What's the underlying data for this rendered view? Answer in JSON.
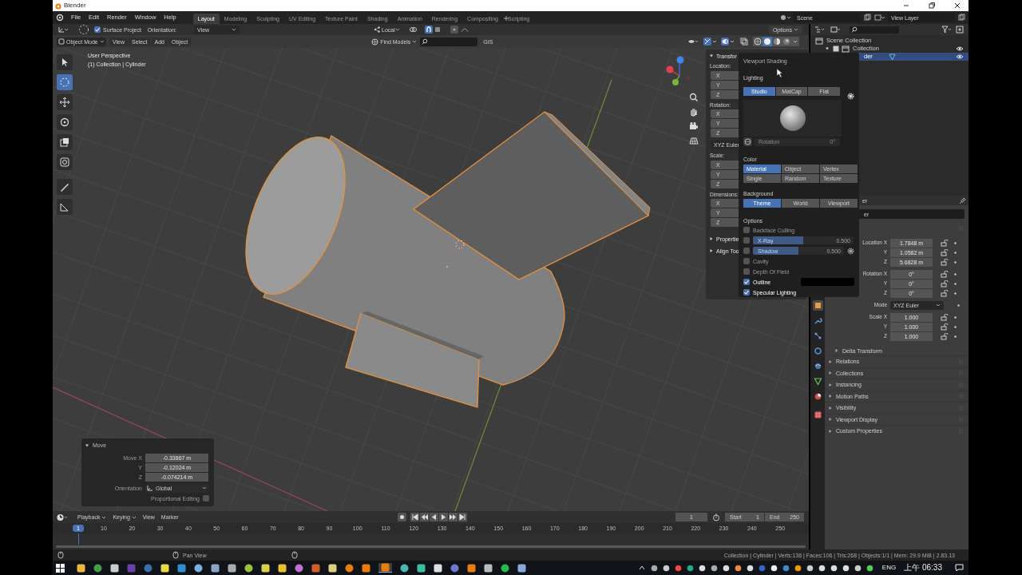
{
  "window": {
    "title": "Blender"
  },
  "menu": [
    "File",
    "Edit",
    "Render",
    "Window",
    "Help"
  ],
  "workspaces": [
    {
      "label": "Layout",
      "selected": true
    },
    {
      "label": "Modeling",
      "selected": false
    },
    {
      "label": "Sculpting",
      "selected": false
    },
    {
      "label": "UV Editing",
      "selected": false
    },
    {
      "label": "Texture Paint",
      "selected": false
    },
    {
      "label": "Shading",
      "selected": false
    },
    {
      "label": "Animation",
      "selected": false
    },
    {
      "label": "Rendering",
      "selected": false
    },
    {
      "label": "Compositing",
      "selected": false
    },
    {
      "label": "Scripting",
      "selected": false
    }
  ],
  "scene": "Scene",
  "view_layer": "View Layer",
  "tool_header": {
    "surface_project": {
      "label": "Surface Project",
      "checked": true
    },
    "orientation_label": "Orientation:",
    "orientation": "View",
    "pivot": "Local",
    "options": "Options"
  },
  "viewport_header": {
    "mode": "Object Mode",
    "menus": [
      "View",
      "Select",
      "Add",
      "Object"
    ],
    "find_models": "Find Models",
    "gis": "GIS",
    "shading_modes": [
      {
        "kind": "wireframe",
        "selected": false
      },
      {
        "kind": "solid",
        "selected": true
      },
      {
        "kind": "material",
        "selected": false
      },
      {
        "kind": "rendered",
        "selected": false
      }
    ]
  },
  "viewport": {
    "view_name": "User Perspective",
    "object_info": "(1) Collection | Cylinder"
  },
  "sidebar": {
    "title": "Transfor",
    "sections": [
      {
        "kind": "group",
        "label": "Location:",
        "axes": [
          "X",
          "Y",
          "Z"
        ]
      },
      {
        "kind": "group",
        "label": "Rotation:",
        "axes": [
          "X",
          "Y",
          "Z"
        ]
      },
      {
        "kind": "mode",
        "label": "XYZ Euler"
      },
      {
        "kind": "group",
        "label": "Scale:",
        "axes": [
          "X",
          "Y",
          "Z"
        ]
      },
      {
        "kind": "group",
        "label": "Dimensions:",
        "axes": [
          "X",
          "Y",
          "Z"
        ]
      }
    ],
    "panels": [
      "Propertie",
      "Align Too"
    ]
  },
  "shading_popover": {
    "title": "Viewport Shading",
    "lighting_label": "Lighting",
    "lighting": [
      {
        "label": "Studio",
        "selected": true
      },
      {
        "label": "MatCap",
        "selected": false
      },
      {
        "label": "Flat",
        "selected": false
      }
    ],
    "rotation_label": "Rotation",
    "rotation": "0°",
    "color_label": "Color",
    "color": [
      {
        "label": "Material",
        "selected": true
      },
      {
        "label": "Object",
        "selected": false
      },
      {
        "label": "Vertex",
        "selected": false
      },
      {
        "label": "Single",
        "selected": false
      },
      {
        "label": "Random",
        "selected": false
      },
      {
        "label": "Texture",
        "selected": false
      }
    ],
    "background_label": "Background",
    "background": [
      {
        "label": "Theme",
        "selected": true
      },
      {
        "label": "World",
        "selected": false
      },
      {
        "label": "Viewport",
        "selected": false
      }
    ],
    "options_label": "Options",
    "options": [
      {
        "kind": "check",
        "label": "Backface Culling",
        "checked": false,
        "disabled": false
      },
      {
        "kind": "slider",
        "label": "X-Ray",
        "checked": false,
        "disabled": true,
        "level": 0.5,
        "value": "0.500",
        "gear": false
      },
      {
        "kind": "slider",
        "label": "Shadow",
        "checked": false,
        "disabled": true,
        "level": 0.5,
        "value": "0.500",
        "gear": true
      },
      {
        "kind": "check",
        "label": "Cavity",
        "checked": false,
        "disabled": false
      },
      {
        "kind": "check",
        "label": "Depth Of Field",
        "checked": false,
        "disabled": false
      },
      {
        "kind": "color",
        "label": "Outline",
        "checked": true,
        "disabled": false,
        "color": "#000000"
      },
      {
        "kind": "check",
        "label": "Specular Lighting",
        "checked": true,
        "disabled": false
      }
    ]
  },
  "move_panel": {
    "title": "Move",
    "fields": [
      {
        "label": "Move X",
        "value": "-0.33867 m"
      },
      {
        "label": "Y",
        "value": "-0.12024 m"
      },
      {
        "label": "Z",
        "value": "-0.074214 m"
      }
    ],
    "orientation_label": "Orientation",
    "orientation": "Global",
    "proportional": {
      "label": "Proportional Editing",
      "checked": false
    }
  },
  "outliner": {
    "items": [
      {
        "label": "Scene Collection",
        "selected": false,
        "children": [
          {
            "label": "Collection",
            "selected": false,
            "children": [
              {
                "label": "der",
                "selected": true
              }
            ]
          }
        ]
      }
    ]
  },
  "properties": {
    "header": "er",
    "name": "er",
    "rows": [
      {
        "kind": "field",
        "label": "Location X",
        "value": "1.7848 m"
      },
      {
        "kind": "field",
        "label": "Y",
        "value": "1.0582 m"
      },
      {
        "kind": "field",
        "label": "Z",
        "value": "5.6828 m"
      },
      {
        "kind": "field",
        "label": "Rotation X",
        "value": "0°"
      },
      {
        "kind": "field",
        "label": "Y",
        "value": "0°"
      },
      {
        "kind": "field",
        "label": "Z",
        "value": "0°"
      },
      {
        "kind": "dropdown",
        "label": "Mode",
        "value": "XYZ Euler"
      },
      {
        "kind": "field",
        "label": "Scale X",
        "value": "1.000"
      },
      {
        "kind": "field",
        "label": "Y",
        "value": "1.000"
      },
      {
        "kind": "field",
        "label": "Z",
        "value": "1.000"
      }
    ],
    "subpanel": "Delta Transform",
    "panels": [
      "Relations",
      "Collections",
      "Instancing",
      "Motion Paths",
      "Visibility",
      "Viewport Display",
      "Custom Properties"
    ]
  },
  "timeline": {
    "menus": [
      "Playback",
      "Keying",
      "View",
      "Marker"
    ],
    "current_frame": "1",
    "start_label": "Start",
    "start": "1",
    "end_label": "End",
    "end": "250",
    "ticks": [
      {
        "label": "1",
        "selected": true
      },
      {
        "label": "10",
        "selected": false
      },
      {
        "label": "20",
        "selected": false
      },
      {
        "label": "30",
        "selected": false
      },
      {
        "label": "40",
        "selected": false
      },
      {
        "label": "50",
        "selected": false
      },
      {
        "label": "60",
        "selected": false
      },
      {
        "label": "70",
        "selected": false
      },
      {
        "label": "80",
        "selected": false
      },
      {
        "label": "90",
        "selected": false
      },
      {
        "label": "100",
        "selected": false
      },
      {
        "label": "110",
        "selected": false
      },
      {
        "label": "120",
        "selected": false
      },
      {
        "label": "130",
        "selected": false
      },
      {
        "label": "140",
        "selected": false
      },
      {
        "label": "150",
        "selected": false
      },
      {
        "label": "160",
        "selected": false
      },
      {
        "label": "170",
        "selected": false
      },
      {
        "label": "180",
        "selected": false
      },
      {
        "label": "190",
        "selected": false
      },
      {
        "label": "200",
        "selected": false
      },
      {
        "label": "210",
        "selected": false
      },
      {
        "label": "220",
        "selected": false
      },
      {
        "label": "230",
        "selected": false
      },
      {
        "label": "240",
        "selected": false
      },
      {
        "label": "250",
        "selected": false
      }
    ]
  },
  "status_bar": {
    "hint": "Pan View",
    "stats": "Collection | Cylinder | Verts:136 | Faces:106 | Tris:268 | Objects:1/1 | Mem: 29.9 MiB | 2.83.13"
  },
  "taskbar": {
    "language": "ENG",
    "clock": "上午 06:33"
  }
}
